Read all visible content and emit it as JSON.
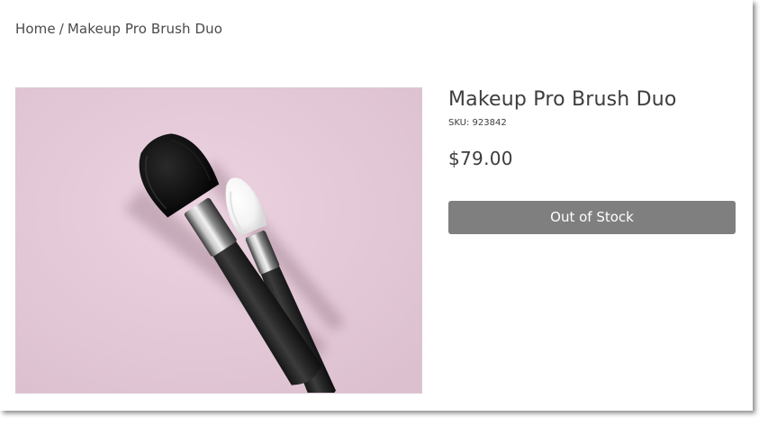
{
  "breadcrumb": {
    "home": "Home",
    "separator": "/",
    "current": "Makeup Pro Brush Duo"
  },
  "product": {
    "title": "Makeup Pro Brush Duo",
    "sku": "SKU: 923842",
    "price": "$79.00",
    "stock_button_label": "Out of Stock",
    "image_icon": "makeup-brushes-photo"
  },
  "colors": {
    "background": "#ffffff",
    "text": "#3d3d3d",
    "button_disabled": "#7f7f7f",
    "button_text": "#ffffff",
    "image_backdrop": "#e6c9d8"
  }
}
